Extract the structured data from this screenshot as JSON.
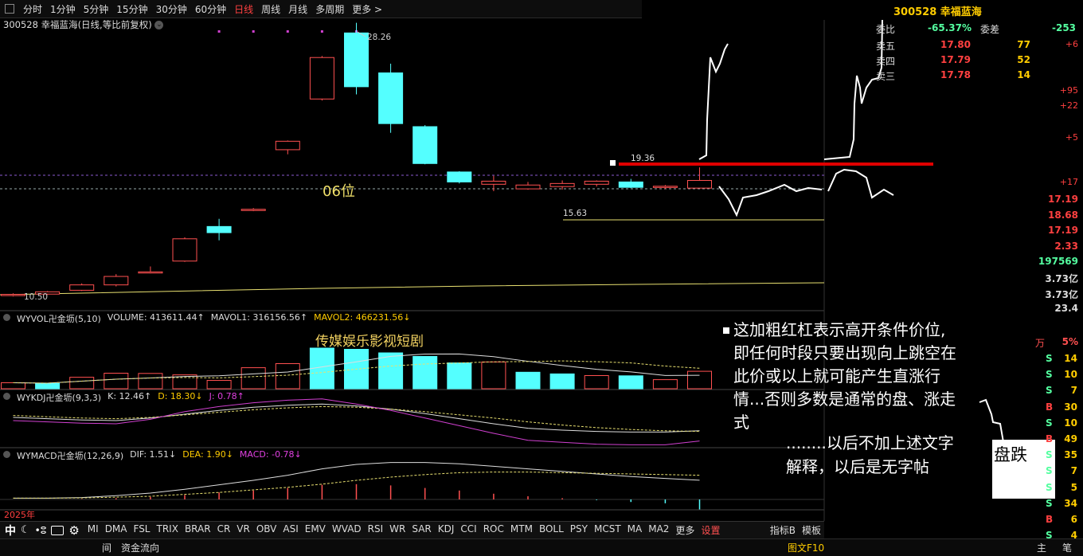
{
  "toolbar": {
    "periods": [
      "分时",
      "1分钟",
      "5分钟",
      "15分钟",
      "30分钟",
      "60分钟",
      "日线",
      "周线",
      "月线",
      "多周期",
      "更多 >"
    ],
    "active": "日线"
  },
  "chart_header": {
    "code": "300528",
    "name": "幸福蓝海",
    "params": "(日线,等比前复权)"
  },
  "price_labels": {
    "high": "28.26",
    "low": "10.50",
    "line1": "19.36",
    "line2": "15.63",
    "pos": "06位"
  },
  "vol_label": {
    "title": "WYVOL卍金坜(5,10)",
    "volume": "VOLUME: 413611.44↑",
    "mavol1": "MAVOL1: 316156.56↑",
    "mavol2": "MAVOL2: 466231.56↓",
    "overlay": "传媒娱乐影视短剧"
  },
  "kdj_label": {
    "title": "WYKDJ卍金坜(9,3,3)",
    "k": "K: 12.46↑",
    "d": "D: 18.30↓",
    "j": "J: 0.78↑"
  },
  "macd_label": {
    "title": "WYMACD卍金坜(12,26,9)",
    "dif": "DIF: 1.51↓",
    "dea": "DEA: 1.90↓",
    "macd": "MACD: -0.78↓"
  },
  "year_label": "2025年",
  "annotation": {
    "main": [
      "这加粗红杠表示高开条件价位,",
      "即任何时段只要出现向上跳空在",
      "此价或以上就可能产生直涨行",
      "情...否则多数是通常的盘、涨走",
      "式"
    ],
    "sub": [
      "........以后不加上述文字",
      "解释，以后是无字帖"
    ],
    "box": "盘跌"
  },
  "quote": {
    "title": "300528 幸福蓝海",
    "ratio_label": "委比",
    "ratio": "-65.37%",
    "diff_label": "委差",
    "diff": "-253",
    "orders": [
      {
        "label": "卖五",
        "price": "17.80",
        "vol": "77",
        "chg": "+6"
      },
      {
        "label": "卖四",
        "price": "17.79",
        "vol": "52",
        "chg": ""
      },
      {
        "label": "卖三",
        "price": "17.78",
        "vol": "14",
        "chg": ""
      }
    ],
    "side_values": [
      "+95",
      "+22",
      "+5",
      "+17"
    ],
    "stats": [
      "17.19",
      "18.68",
      "17.19",
      "2.33",
      "197569",
      "3.73亿",
      "3.73亿",
      "23.4"
    ],
    "wan": "万",
    "pct": "5%",
    "ticks": [
      {
        "s": "S",
        "n": "14"
      },
      {
        "s": "S",
        "n": "10"
      },
      {
        "s": "S",
        "n": "7"
      },
      {
        "s": "B",
        "n": "30"
      },
      {
        "s": "S",
        "n": "10"
      },
      {
        "s": "B",
        "n": "49"
      },
      {
        "s": "S",
        "n": "35"
      },
      {
        "s": "S",
        "n": "7"
      },
      {
        "s": "S",
        "n": "5"
      },
      {
        "s": "S",
        "n": "34"
      },
      {
        "s": "B",
        "n": "6"
      },
      {
        "s": "S",
        "n": "4"
      }
    ],
    "bottom_tabs": [
      "主",
      "笔"
    ]
  },
  "tabs": [
    "MI",
    "DMA",
    "FSL",
    "TRIX",
    "BRAR",
    "CR",
    "VR",
    "OBV",
    "ASI",
    "EMV",
    "WVAD",
    "RSI",
    "WR",
    "SAR",
    "KDJ",
    "CCI",
    "ROC",
    "MTM",
    "BOLL",
    "PSY",
    "MCST",
    "MA",
    "MA2",
    "更多",
    "设置"
  ],
  "tabs_right": [
    "指标B",
    "模板"
  ],
  "bottom_bar": {
    "left": "间",
    "fund": "资金流向",
    "right": "图文F10"
  },
  "icons": [
    "中",
    "moon",
    "dots",
    "keyboard",
    "gear"
  ],
  "colors": {
    "up": "#ff5050",
    "down": "#54ffff",
    "red_bar": "#e00000",
    "yellow": "#ffcc00",
    "magenta": "#d040d0"
  },
  "candles": [
    {
      "o": 10.55,
      "c": 10.58,
      "h": 10.65,
      "l": 10.45
    },
    {
      "o": 10.6,
      "c": 10.75,
      "h": 10.8,
      "l": 10.55
    },
    {
      "o": 10.85,
      "c": 11.2,
      "h": 11.3,
      "l": 10.8
    },
    {
      "o": 11.2,
      "c": 11.75,
      "h": 11.9,
      "l": 11.1
    },
    {
      "o": 12.05,
      "c": 12.05,
      "h": 12.4,
      "l": 11.95
    },
    {
      "o": 12.75,
      "c": 14.2,
      "h": 14.3,
      "l": 12.7
    },
    {
      "o": 15.0,
      "c": 14.6,
      "h": 15.5,
      "l": 14.1
    },
    {
      "o": 16.1,
      "c": 16.12,
      "h": 16.2,
      "l": 16.0
    },
    {
      "o": 20.0,
      "c": 20.55,
      "h": 20.6,
      "l": 19.7
    },
    {
      "o": 23.3,
      "c": 26.0,
      "h": 26.1,
      "l": 23.2
    },
    {
      "o": 27.6,
      "c": 24.1,
      "h": 28.26,
      "l": 23.6
    },
    {
      "o": 25.0,
      "c": 21.7,
      "h": 25.6,
      "l": 21.1
    },
    {
      "o": 21.5,
      "c": 19.1,
      "h": 21.6,
      "l": 19.05
    },
    {
      "o": 18.55,
      "c": 17.9,
      "h": 18.6,
      "l": 17.8
    },
    {
      "o": 17.75,
      "c": 17.95,
      "h": 18.3,
      "l": 17.3
    },
    {
      "o": 17.45,
      "c": 17.7,
      "h": 17.9,
      "l": 17.4
    },
    {
      "o": 17.6,
      "c": 17.8,
      "h": 18.0,
      "l": 17.4
    },
    {
      "o": 17.75,
      "c": 17.95,
      "h": 18.0,
      "l": 17.6
    },
    {
      "o": 17.9,
      "c": 17.55,
      "h": 18.1,
      "l": 17.5
    },
    {
      "o": 17.6,
      "c": 17.62,
      "h": 17.7,
      "l": 17.45
    },
    {
      "o": 17.5,
      "c": 18.0,
      "h": 18.85,
      "l": 17.5
    }
  ],
  "volumes": [
    0.25,
    0.22,
    0.48,
    0.65,
    0.64,
    0.58,
    0.35,
    0.88,
    1.05,
    1.7,
    1.65,
    1.5,
    1.35,
    1.08,
    1.12,
    0.69,
    0.62,
    0.55,
    0.54,
    0.38,
    0.73
  ],
  "vol_bar_up": [
    true,
    false,
    true,
    true,
    true,
    true,
    true,
    true,
    true,
    false,
    false,
    false,
    false,
    false,
    true,
    false,
    false,
    true,
    false,
    true,
    true
  ],
  "kdj_k": [
    45,
    43,
    41,
    40,
    44,
    50,
    56,
    61,
    64,
    66,
    63,
    58,
    51,
    43,
    35,
    28,
    25,
    23,
    22,
    22,
    24
  ],
  "kdj_d": [
    48,
    46,
    44,
    43,
    45,
    49,
    53,
    57,
    60,
    62,
    61,
    58,
    54,
    49,
    44,
    38,
    33,
    29,
    26,
    24,
    23
  ],
  "kdj_j": [
    40,
    38,
    36,
    35,
    42,
    54,
    62,
    68,
    72,
    74,
    66,
    56,
    44,
    32,
    20,
    9,
    6,
    3,
    2,
    2,
    8
  ],
  "macd_dif": [
    0.1,
    0.1,
    0.15,
    0.3,
    0.5,
    0.8,
    1.15,
    1.5,
    1.9,
    2.4,
    2.75,
    2.9,
    2.9,
    2.8,
    2.6,
    2.4,
    2.2,
    2.0,
    1.8,
    1.65,
    1.51
  ],
  "macd_dea": [
    0.1,
    0.1,
    0.12,
    0.18,
    0.25,
    0.4,
    0.55,
    0.75,
    0.95,
    1.2,
    1.5,
    1.75,
    1.95,
    2.1,
    2.15,
    2.15,
    2.1,
    2.05,
    2.0,
    1.95,
    1.9
  ],
  "macd_hist": [
    0,
    0,
    0.03,
    0.1,
    0.2,
    0.35,
    0.55,
    0.7,
    0.9,
    1.15,
    1.2,
    1.1,
    0.9,
    0.7,
    0.45,
    0.25,
    0.1,
    -0.05,
    -0.2,
    -0.3,
    -0.78
  ]
}
